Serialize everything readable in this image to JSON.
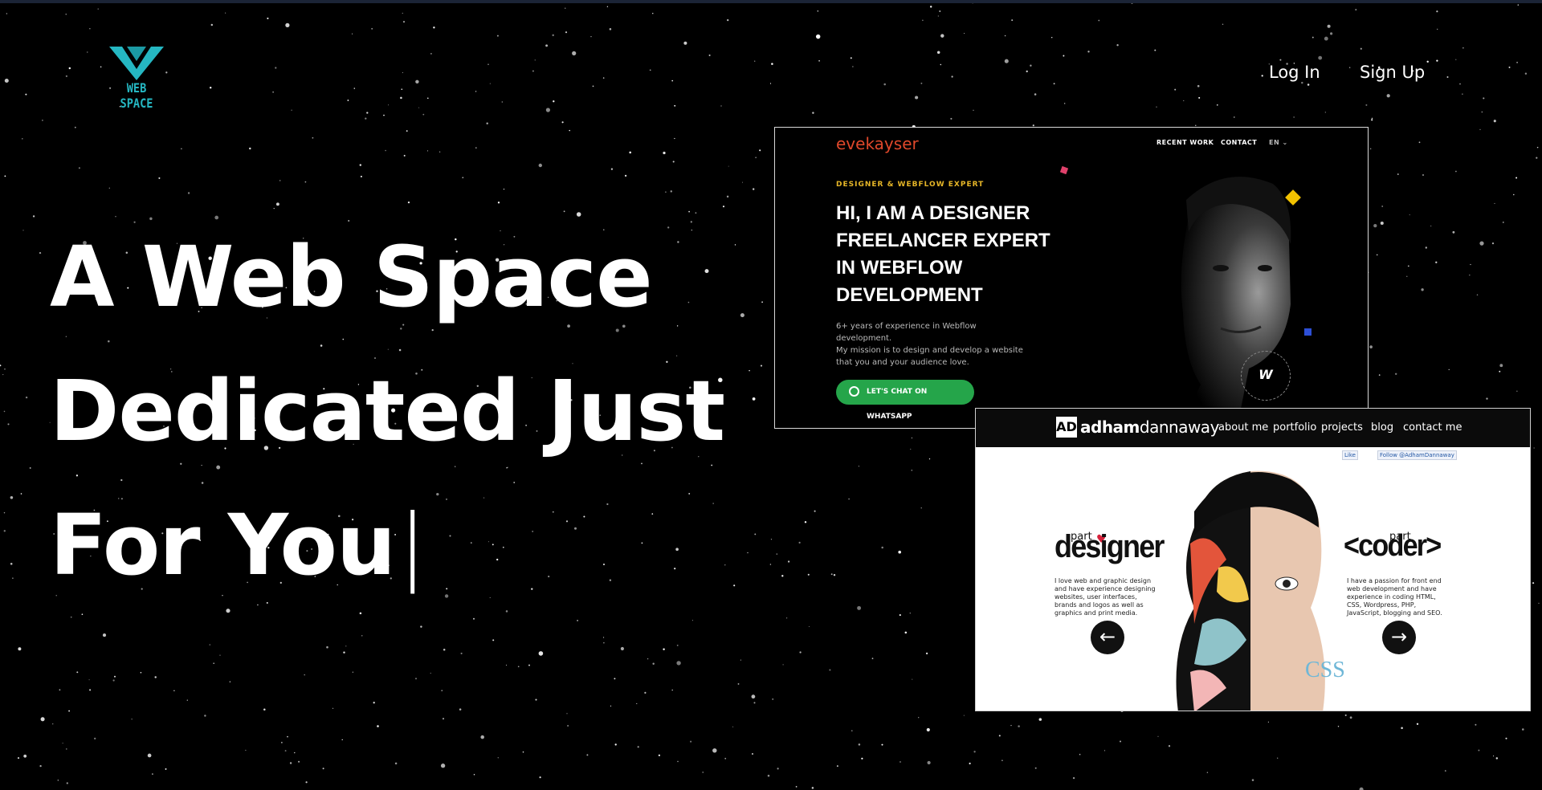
{
  "brand": {
    "name": "WEB SPACE",
    "accent": "#25b7c2"
  },
  "nav": {
    "login": "Log In",
    "signup": "Sign Up"
  },
  "hero": {
    "line1": "A Web Space",
    "line2": "Dedicated Just",
    "line3": "For You",
    "cursor": "|"
  },
  "showcase1": {
    "brand": "evekayser",
    "nav": [
      "RECENT WORK",
      "CONTACT",
      "EN ⌄"
    ],
    "eyebrow": "DESIGNER & WEBFLOW EXPERT",
    "heading": [
      "HI, I AM A DESIGNER",
      "FREELANCER EXPERT",
      "IN WEBFLOW",
      "DEVELOPMENT"
    ],
    "body": [
      "6+ years of experience in Webflow development.",
      "My mission is to design and develop a website",
      "that you and your audience love."
    ],
    "cta": "LET'S CHAT ON WHATSAPP",
    "badge": "W",
    "accent": "#25a54a"
  },
  "showcase2": {
    "logo_mark": "AD",
    "brand_bold": "adham",
    "brand_light": "dannaway",
    "nav": [
      "about me",
      "portfolio",
      "projects",
      "blog",
      "contact me"
    ],
    "social": [
      "Like",
      "Follow @AdhamDannaway"
    ],
    "left_part": "part",
    "left_title": "designer",
    "left_text": "I love web and graphic design and have experience designing websites, user interfaces, brands and logos as well as graphics and print media.",
    "right_part": "part",
    "right_title": "<coder>",
    "right_text": "I have a passion for front end web development and have experience in coding HTML, CSS, Wordpress, PHP, JavaScript, blogging and SEO.",
    "code_word": "CSS"
  }
}
